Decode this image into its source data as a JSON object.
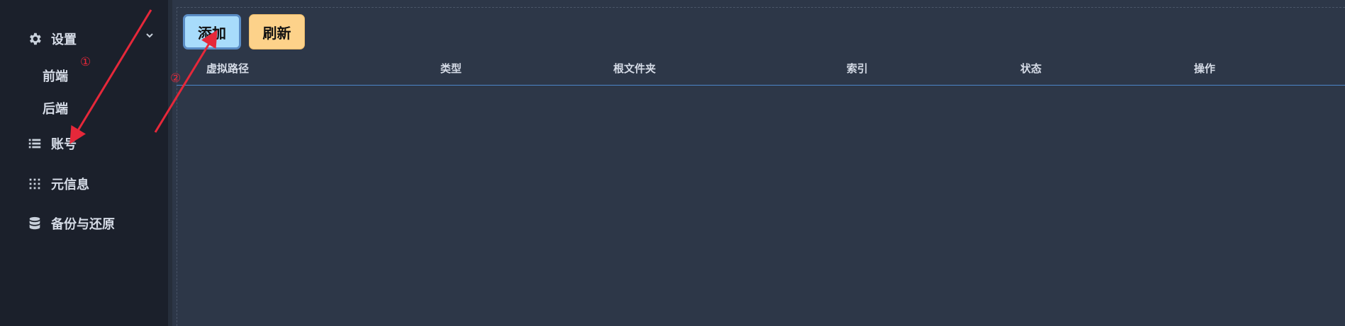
{
  "sidebar": {
    "settings": {
      "label": "设置",
      "icon": "gear-icon",
      "expanded": true
    },
    "sub_items": [
      {
        "label": "前端"
      },
      {
        "label": "后端"
      }
    ],
    "items": [
      {
        "label": "账号",
        "icon": "list-icon"
      },
      {
        "label": "元信息",
        "icon": "grid-icon"
      },
      {
        "label": "备份与还原",
        "icon": "database-icon"
      }
    ]
  },
  "toolbar": {
    "add_label": "添加",
    "refresh_label": "刷新"
  },
  "table": {
    "columns": [
      "虚拟路径",
      "类型",
      "根文件夹",
      "索引",
      "状态",
      "操作"
    ],
    "rows": []
  },
  "annotations": {
    "marker_1": "①",
    "marker_2": "②",
    "arrow_color": "#e6283a"
  },
  "colors": {
    "sidebar_bg": "#1b202b",
    "main_bg": "#2d3748",
    "add_button_bg": "#a8dcfb",
    "refresh_button_bg": "#fdd28a",
    "header_line": "#4c86c8"
  }
}
